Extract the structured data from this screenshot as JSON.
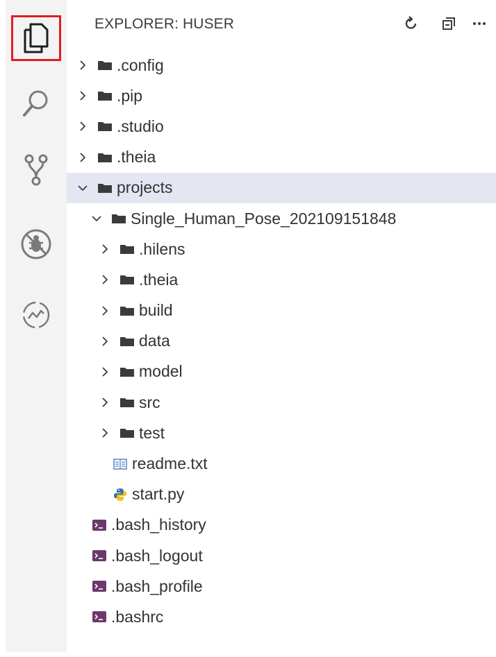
{
  "activity_bar": {
    "items": [
      {
        "name": "explorer-icon"
      },
      {
        "name": "search-icon"
      },
      {
        "name": "source-control-icon"
      },
      {
        "name": "debug-icon"
      },
      {
        "name": "timeline-icon"
      }
    ],
    "selected": "explorer-icon",
    "highlight_color": "#e01e1e"
  },
  "explorer": {
    "title": "EXPLORER: HUSER",
    "actions": [
      "refresh-icon",
      "collapse-all-icon",
      "more-icon"
    ],
    "tree": [
      {
        "label": ".config",
        "type": "folder",
        "expanded": false,
        "depth": 0
      },
      {
        "label": ".pip",
        "type": "folder",
        "expanded": false,
        "depth": 0
      },
      {
        "label": ".studio",
        "type": "folder",
        "expanded": false,
        "depth": 0
      },
      {
        "label": ".theia",
        "type": "folder",
        "expanded": false,
        "depth": 0
      },
      {
        "label": "projects",
        "type": "folder",
        "expanded": true,
        "depth": 0,
        "selected": true
      },
      {
        "label": "Single_Human_Pose_202109151848",
        "type": "folder",
        "expanded": true,
        "depth": 1
      },
      {
        "label": ".hilens",
        "type": "folder",
        "expanded": false,
        "depth": 2
      },
      {
        "label": ".theia",
        "type": "folder",
        "expanded": false,
        "depth": 2
      },
      {
        "label": "build",
        "type": "folder",
        "expanded": false,
        "depth": 2
      },
      {
        "label": "data",
        "type": "folder",
        "expanded": false,
        "depth": 2
      },
      {
        "label": "model",
        "type": "folder",
        "expanded": false,
        "depth": 2
      },
      {
        "label": "src",
        "type": "folder",
        "expanded": false,
        "depth": 2
      },
      {
        "label": "test",
        "type": "folder",
        "expanded": false,
        "depth": 2
      },
      {
        "label": "readme.txt",
        "type": "text-file",
        "depth": 2
      },
      {
        "label": "start.py",
        "type": "python-file",
        "depth": 2
      },
      {
        "label": ".bash_history",
        "type": "shell-file",
        "depth": 0
      },
      {
        "label": ".bash_logout",
        "type": "shell-file",
        "depth": 0
      },
      {
        "label": ".bash_profile",
        "type": "shell-file",
        "depth": 0
      },
      {
        "label": ".bashrc",
        "type": "shell-file",
        "depth": 0
      }
    ]
  },
  "colors": {
    "activity_bar_bg": "#f3f3f3",
    "selected_row_bg": "#e4e6f1",
    "folder_icon": "#3b3b3b",
    "shell_icon": "#6b3a6b",
    "python_icon": "#3572a5",
    "text_icon": "#5b8dbd"
  }
}
